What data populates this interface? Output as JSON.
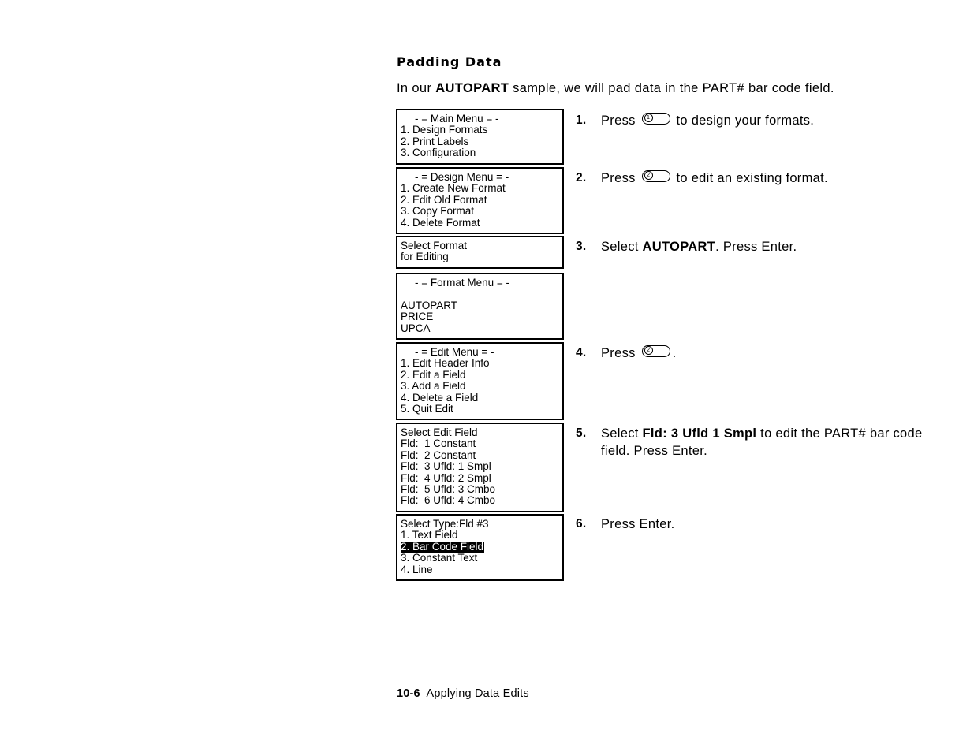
{
  "heading": "Padding Data",
  "intro": {
    "before": "In our ",
    "bold": "AUTOPART",
    "after": " sample, we will pad data in the PART# bar code field."
  },
  "screens": {
    "main_menu": {
      "title": "- = Main Menu = -",
      "items": [
        "1. Design Formats",
        "2. Print Labels",
        "3. Configuration"
      ]
    },
    "design_menu": {
      "title": "- = Design Menu = -",
      "items": [
        "1. Create New Format",
        "2. Edit Old Format",
        "3. Copy Format",
        "4. Delete Format"
      ]
    },
    "select_format": {
      "line1": "Select Format",
      "line2": "for Editing"
    },
    "format_menu": {
      "title": "- = Format Menu = -",
      "items": [
        "AUTOPART",
        "PRICE",
        "UPCA"
      ]
    },
    "edit_menu": {
      "title": "- = Edit Menu = -",
      "items": [
        "1. Edit Header Info",
        "2. Edit a Field",
        "3. Add a Field",
        "4. Delete a Field",
        "5. Quit Edit"
      ]
    },
    "select_edit_field": {
      "title": "Select Edit Field",
      "items": [
        "Fld:  1 Constant",
        "Fld:  2 Constant",
        "Fld:  3 Ufld: 1 Smpl",
        "Fld:  4 Ufld: 2 Smpl",
        "Fld:  5 Ufld: 3 Cmbo",
        "Fld:  6 Ufld: 4 Cmbo"
      ]
    },
    "select_type": {
      "title": "Select Type:Fld #3",
      "items": [
        "1. Text Field",
        "2. Bar Code Field",
        "3. Constant Text",
        "4. Line"
      ],
      "selected_index": 1
    }
  },
  "steps": {
    "s1": {
      "num": "1.",
      "text_before": "Press ",
      "key": "1",
      "text_after": " to design your formats."
    },
    "s2": {
      "num": "2.",
      "text_before": "Press ",
      "key": "2",
      "text_after": " to edit an existing format."
    },
    "s3": {
      "num": "3.",
      "before": "Select ",
      "bold": "AUTOPART",
      "after": ".  Press Enter."
    },
    "s4": {
      "num": "4.",
      "text_before": "Press ",
      "key": "2",
      "text_after": "."
    },
    "s5": {
      "num": "5.",
      "before": "Select ",
      "bold": "Fld:  3 Ufld 1 Smpl",
      "after": " to edit the PART# bar code field.  Press Enter."
    },
    "s6": {
      "num": "6.",
      "text": "Press Enter."
    }
  },
  "footer": {
    "page": "10-6",
    "label": "Applying Data Edits"
  },
  "colors": {
    "ink": "#000000",
    "paper": "#ffffff",
    "highlight_bg": "#000000",
    "highlight_fg": "#ffffff"
  }
}
